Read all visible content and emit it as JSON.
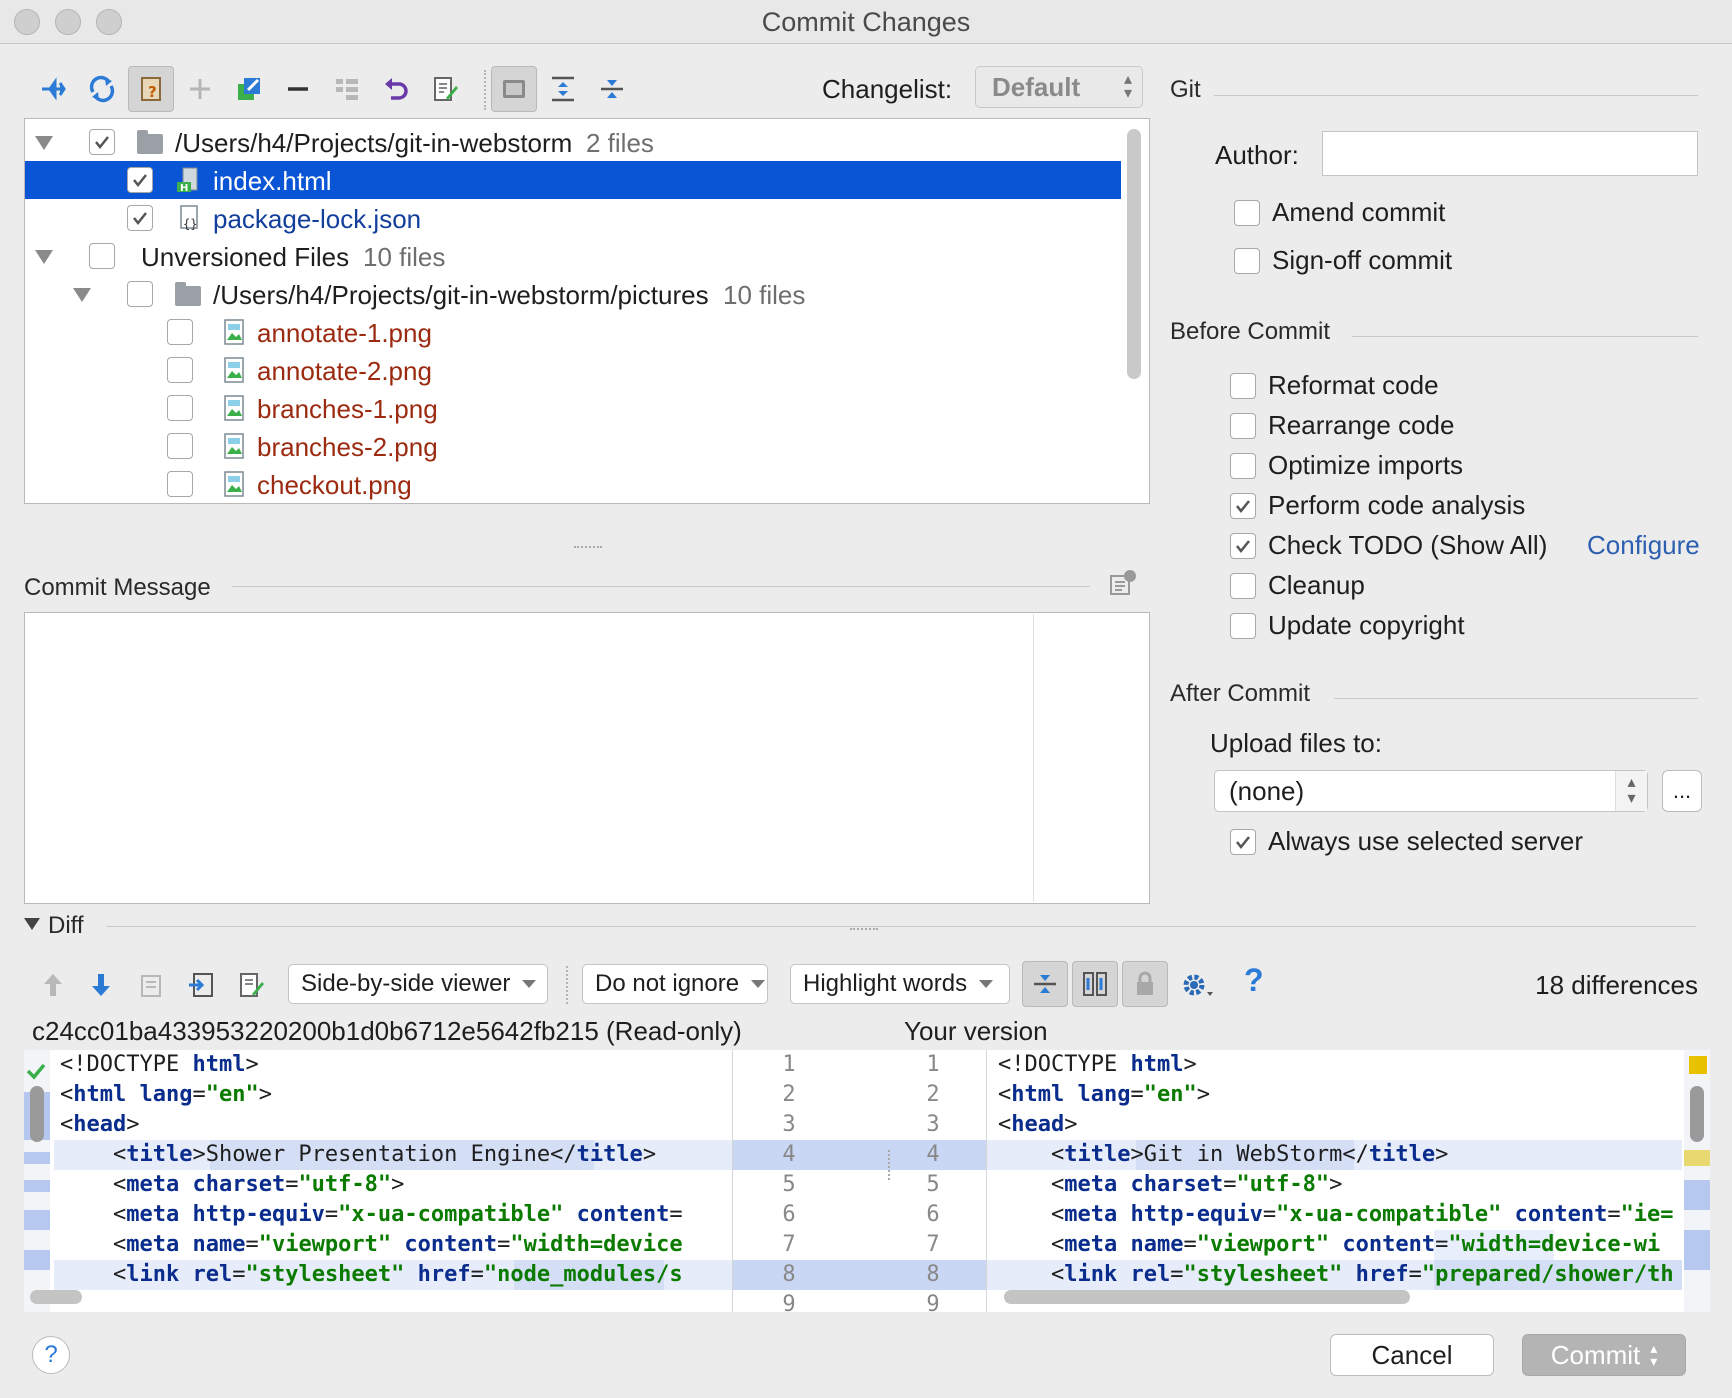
{
  "window": {
    "title": "Commit Changes"
  },
  "toolbar": {
    "changelist_label": "Changelist:",
    "changelist_value": "Default"
  },
  "tree": [
    {
      "kind": "folder",
      "label": "/Users/h4/Projects/git-in-webstorm",
      "count": "2 files",
      "checked": true
    },
    {
      "kind": "file",
      "label": "index.html",
      "checked": true,
      "selected": true,
      "icon": "html-file-icon"
    },
    {
      "kind": "file",
      "label": "package-lock.json",
      "checked": true,
      "icon": "json-file-icon"
    },
    {
      "kind": "group",
      "label": "Unversioned Files",
      "count": "10 files",
      "checked": false
    },
    {
      "kind": "folder",
      "label": "/Users/h4/Projects/git-in-webstorm/pictures",
      "count": "10 files",
      "checked": false
    },
    {
      "kind": "image",
      "label": "annotate-1.png",
      "checked": false
    },
    {
      "kind": "image",
      "label": "annotate-2.png",
      "checked": false
    },
    {
      "kind": "image",
      "label": "branches-1.png",
      "checked": false
    },
    {
      "kind": "image",
      "label": "branches-2.png",
      "checked": false
    },
    {
      "kind": "image",
      "label": "checkout.png",
      "checked": false
    }
  ],
  "commit_message": {
    "label": "Commit Message",
    "value": ""
  },
  "git": {
    "section": "Git",
    "author_label": "Author:",
    "author_value": "",
    "amend": "Amend commit",
    "signoff": "Sign-off commit"
  },
  "before_commit": {
    "section": "Before Commit",
    "options": [
      {
        "label": "Reformat code",
        "checked": false
      },
      {
        "label": "Rearrange code",
        "checked": false
      },
      {
        "label": "Optimize imports",
        "checked": false
      },
      {
        "label": "Perform code analysis",
        "checked": true
      },
      {
        "label": "Check TODO (Show All)",
        "checked": true
      },
      {
        "label": "Cleanup",
        "checked": false
      },
      {
        "label": "Update copyright",
        "checked": false
      }
    ],
    "configure_link": "Configure"
  },
  "after_commit": {
    "section": "After Commit",
    "upload_label": "Upload files to:",
    "upload_value": "(none)",
    "browse": "...",
    "always_use": "Always use selected server"
  },
  "diff": {
    "label": "Diff",
    "viewer": "Side-by-side viewer",
    "ignore": "Do not ignore",
    "highlight": "Highlight words",
    "differences": "18 differences",
    "left_title": "c24cc01ba433953220200b1d0b6712e5642fb215 (Read-only)",
    "right_title": "Your version",
    "line_numbers": [
      "1",
      "2",
      "3",
      "4",
      "5",
      "6",
      "7",
      "8",
      "9"
    ],
    "left_lines": [
      [
        [
          "t",
          "<!DOCTYPE "
        ],
        [
          "k",
          "html"
        ],
        [
          "t",
          ">"
        ]
      ],
      [
        [
          "t",
          "<"
        ],
        [
          "k",
          "html"
        ],
        [
          "t",
          " "
        ],
        [
          "a",
          "lang"
        ],
        [
          "t",
          "="
        ],
        [
          "s",
          "\"en\""
        ],
        [
          "t",
          ">"
        ]
      ],
      [
        [
          "t",
          "<"
        ],
        [
          "k",
          "head"
        ],
        [
          "t",
          ">"
        ]
      ],
      [
        [
          "t",
          "    <"
        ],
        [
          "k",
          "title"
        ],
        [
          "t",
          ">Shower Presentation Engine</"
        ],
        [
          "k",
          "title"
        ],
        [
          "t",
          ">"
        ]
      ],
      [
        [
          "t",
          "    <"
        ],
        [
          "k",
          "meta"
        ],
        [
          "t",
          " "
        ],
        [
          "a",
          "charset"
        ],
        [
          "t",
          "="
        ],
        [
          "s",
          "\"utf-8\""
        ],
        [
          "t",
          ">"
        ]
      ],
      [
        [
          "t",
          "    <"
        ],
        [
          "k",
          "meta"
        ],
        [
          "t",
          " "
        ],
        [
          "a",
          "http-equiv"
        ],
        [
          "t",
          "="
        ],
        [
          "s",
          "\"x-ua-compatible\""
        ],
        [
          "t",
          " "
        ],
        [
          "a",
          "content"
        ],
        [
          "t",
          "="
        ]
      ],
      [
        [
          "t",
          "    <"
        ],
        [
          "k",
          "meta"
        ],
        [
          "t",
          " "
        ],
        [
          "a",
          "name"
        ],
        [
          "t",
          "="
        ],
        [
          "s",
          "\"viewport\""
        ],
        [
          "t",
          " "
        ],
        [
          "a",
          "content"
        ],
        [
          "t",
          "="
        ],
        [
          "s",
          "\"width=device"
        ]
      ],
      [
        [
          "t",
          "    <"
        ],
        [
          "k",
          "link"
        ],
        [
          "t",
          " "
        ],
        [
          "a",
          "rel"
        ],
        [
          "t",
          "="
        ],
        [
          "s",
          "\"stylesheet\""
        ],
        [
          "t",
          " "
        ],
        [
          "a",
          "href"
        ],
        [
          "t",
          "="
        ],
        [
          "s",
          "\"node_modules/s"
        ]
      ]
    ],
    "right_lines": [
      [
        [
          "t",
          "<!DOCTYPE "
        ],
        [
          "k",
          "html"
        ],
        [
          "t",
          ">"
        ]
      ],
      [
        [
          "t",
          "<"
        ],
        [
          "k",
          "html"
        ],
        [
          "t",
          " "
        ],
        [
          "a",
          "lang"
        ],
        [
          "t",
          "="
        ],
        [
          "s",
          "\"en\""
        ],
        [
          "t",
          ">"
        ]
      ],
      [
        [
          "t",
          "<"
        ],
        [
          "k",
          "head"
        ],
        [
          "t",
          ">"
        ]
      ],
      [
        [
          "t",
          "    <"
        ],
        [
          "k",
          "title"
        ],
        [
          "t",
          ">Git in WebStorm</"
        ],
        [
          "k",
          "title"
        ],
        [
          "t",
          ">"
        ]
      ],
      [
        [
          "t",
          "    <"
        ],
        [
          "k",
          "meta"
        ],
        [
          "t",
          " "
        ],
        [
          "a",
          "charset"
        ],
        [
          "t",
          "="
        ],
        [
          "s",
          "\"utf-8\""
        ],
        [
          "t",
          ">"
        ]
      ],
      [
        [
          "t",
          "    <"
        ],
        [
          "k",
          "meta"
        ],
        [
          "t",
          " "
        ],
        [
          "a",
          "http-equiv"
        ],
        [
          "t",
          "="
        ],
        [
          "s",
          "\"x-ua-compatible\""
        ],
        [
          "t",
          " "
        ],
        [
          "a",
          "content"
        ],
        [
          "t",
          "="
        ],
        [
          "s",
          "\"ie="
        ]
      ],
      [
        [
          "t",
          "    <"
        ],
        [
          "k",
          "meta"
        ],
        [
          "t",
          " "
        ],
        [
          "a",
          "name"
        ],
        [
          "t",
          "="
        ],
        [
          "s",
          "\"viewport\""
        ],
        [
          "t",
          " "
        ],
        [
          "a",
          "content"
        ],
        [
          "t",
          "="
        ],
        [
          "s",
          "\"width=device-wi"
        ]
      ],
      [
        [
          "t",
          "    <"
        ],
        [
          "k",
          "link"
        ],
        [
          "t",
          " "
        ],
        [
          "a",
          "rel"
        ],
        [
          "t",
          "="
        ],
        [
          "s",
          "\"stylesheet\""
        ],
        [
          "t",
          " "
        ],
        [
          "a",
          "href"
        ],
        [
          "t",
          "="
        ],
        [
          "s",
          "\"prepared/shower/th"
        ]
      ]
    ]
  },
  "footer": {
    "help": "?",
    "cancel": "Cancel",
    "commit": "Commit"
  }
}
